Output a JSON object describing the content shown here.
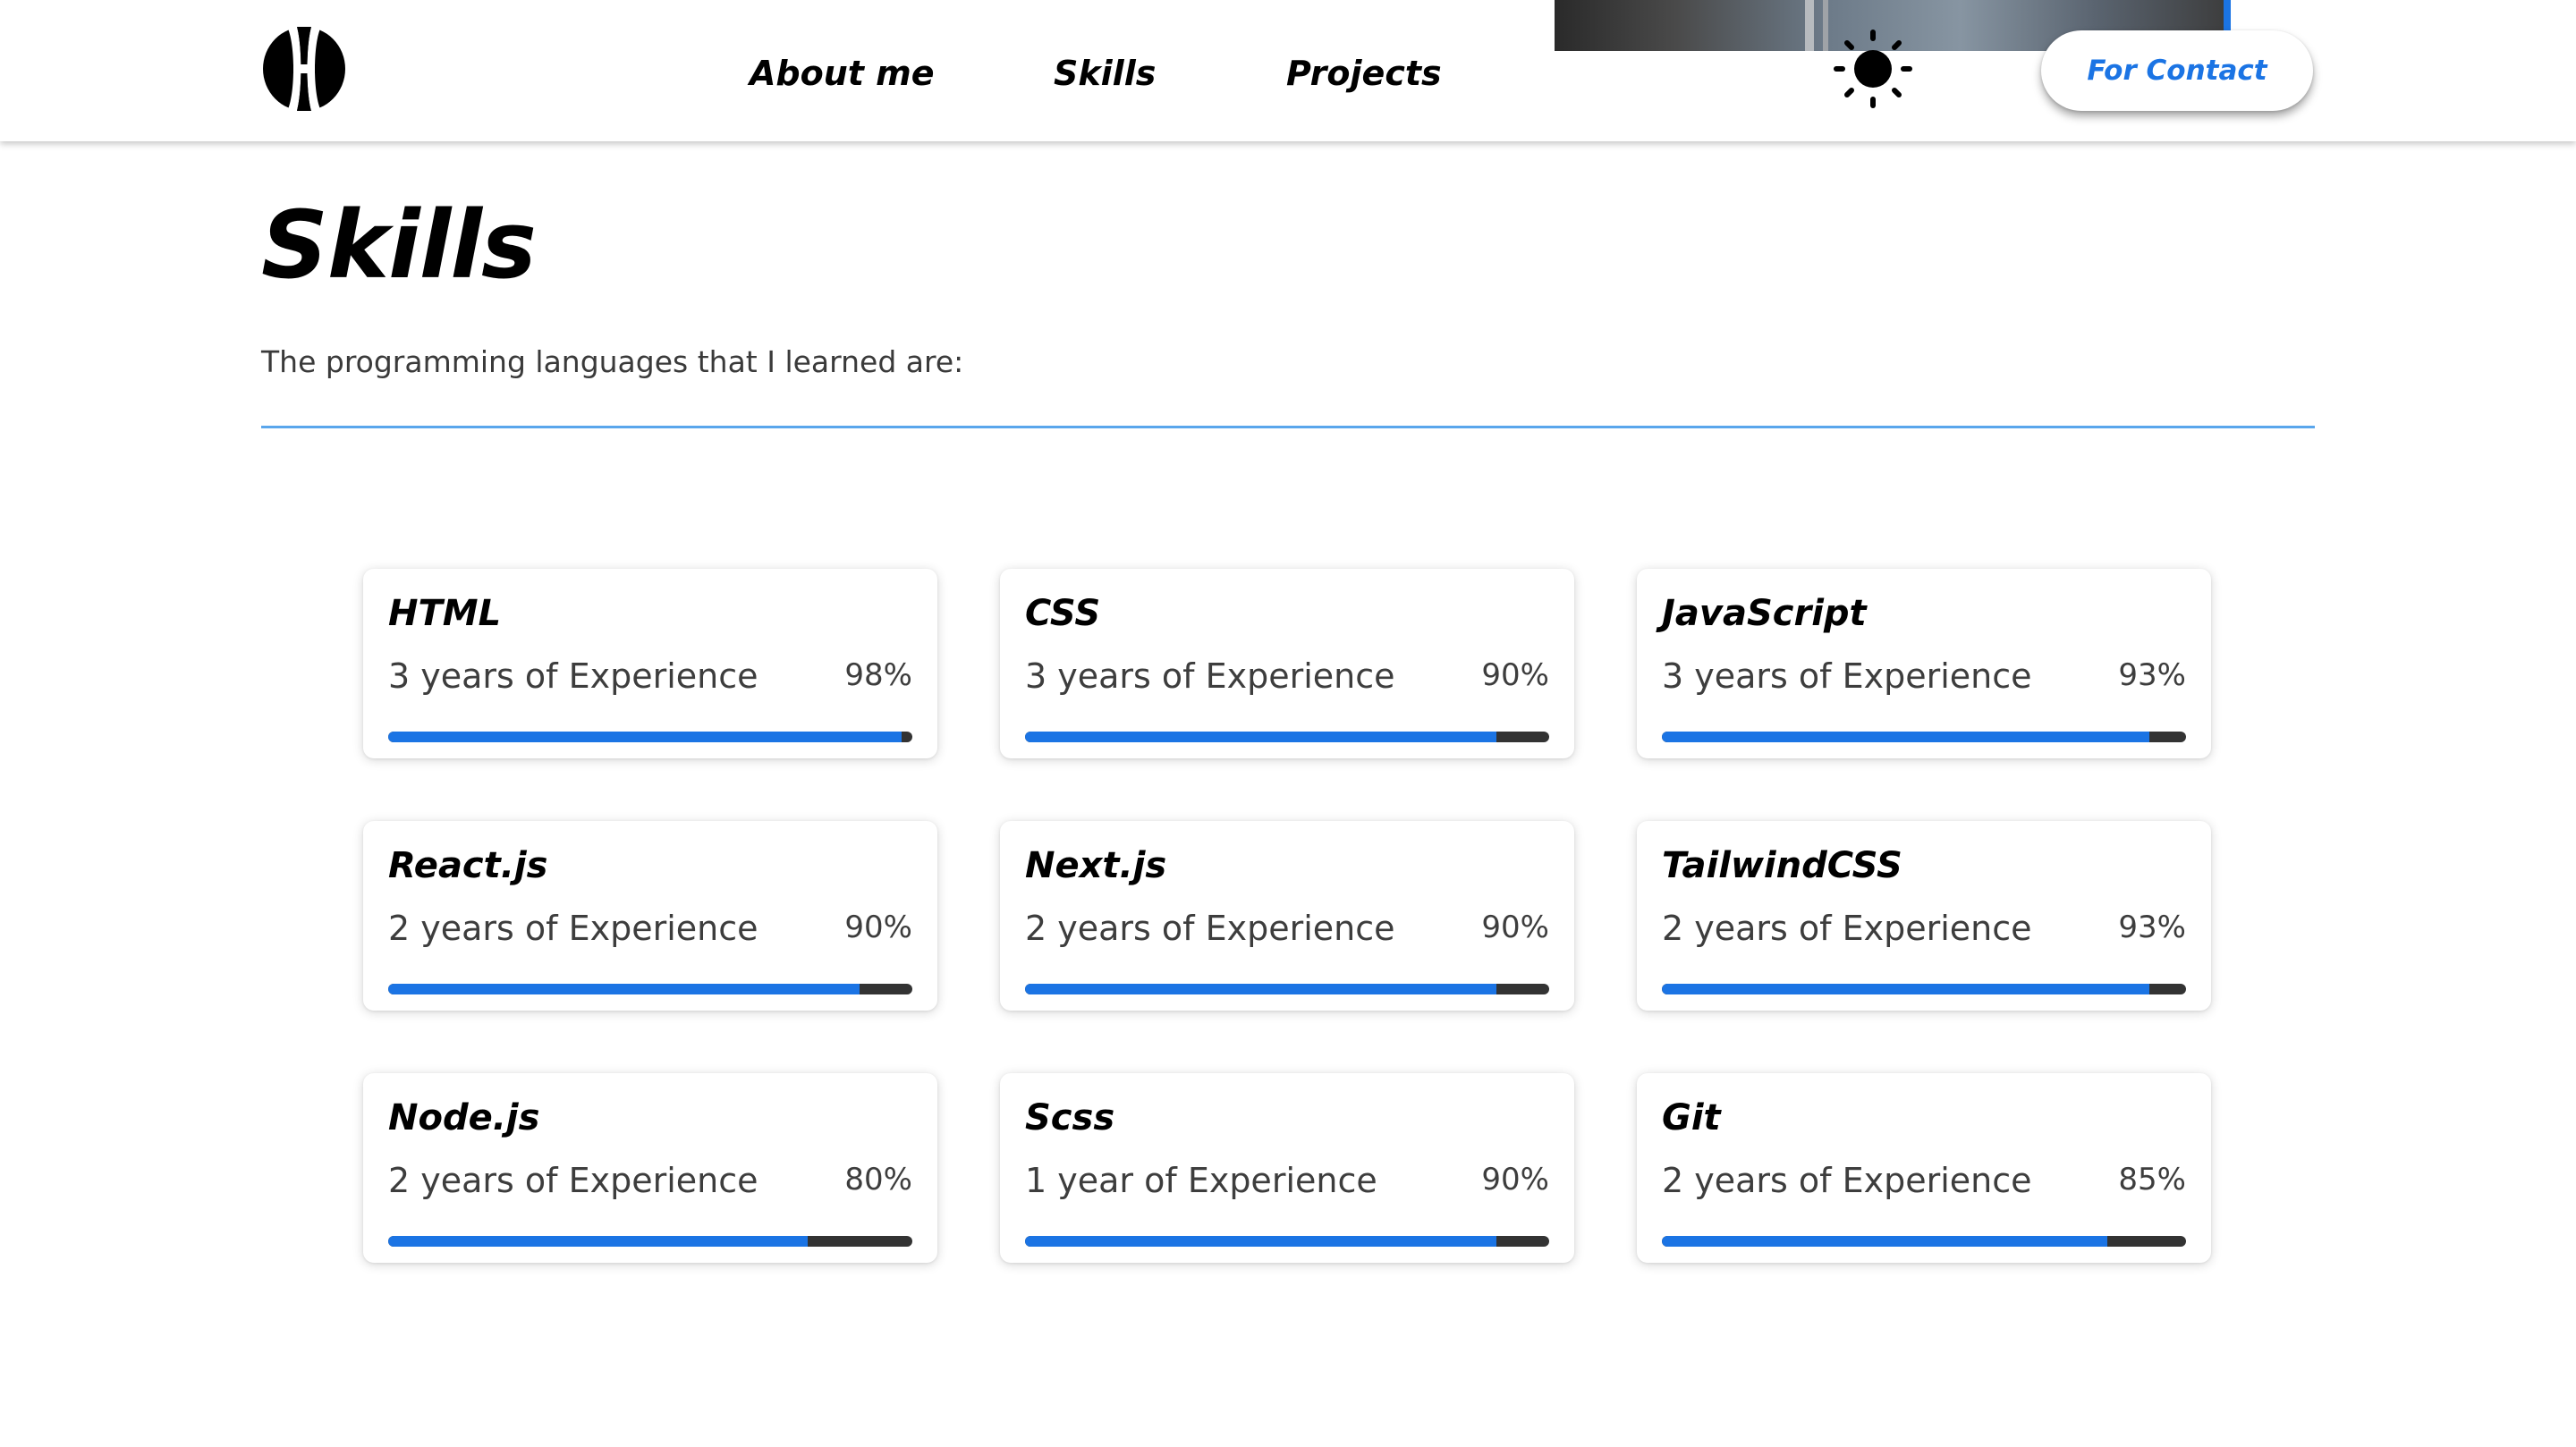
{
  "header": {
    "logo_icon": "monogram-logo-icon",
    "nav": [
      {
        "label": "About me"
      },
      {
        "label": "Skills"
      },
      {
        "label": "Projects"
      }
    ],
    "theme_icon": "sun-icon",
    "contact_label": "For Contact"
  },
  "colors": {
    "accent": "#1b74e4",
    "track": "#333333",
    "divider": "#5aa6ec"
  },
  "main": {
    "title": "Skills",
    "subtitle": "The programming languages that I learned are:",
    "skills": [
      {
        "name": "HTML",
        "experience": "3 years of Experience",
        "percent_label": "98%",
        "percent": 98
      },
      {
        "name": "CSS",
        "experience": "3 years of Experience",
        "percent_label": "90%",
        "percent": 90
      },
      {
        "name": "JavaScript",
        "experience": "3 years of Experience",
        "percent_label": "93%",
        "percent": 93
      },
      {
        "name": "React.js",
        "experience": "2 years of Experience",
        "percent_label": "90%",
        "percent": 90
      },
      {
        "name": "Next.js",
        "experience": "2 years of Experience",
        "percent_label": "90%",
        "percent": 90
      },
      {
        "name": "TailwindCSS",
        "experience": "2 years of Experience",
        "percent_label": "93%",
        "percent": 93
      },
      {
        "name": "Node.js",
        "experience": "2 years of Experience",
        "percent_label": "80%",
        "percent": 80
      },
      {
        "name": "Scss",
        "experience": "1 year of Experience",
        "percent_label": "90%",
        "percent": 90
      },
      {
        "name": "Git",
        "experience": "2 years of Experience",
        "percent_label": "85%",
        "percent": 85
      }
    ]
  }
}
